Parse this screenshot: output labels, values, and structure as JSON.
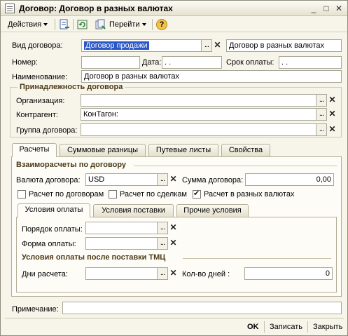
{
  "window": {
    "title": "Договор: Договор  в разных валютах"
  },
  "toolbar": {
    "actions_label": "Действия",
    "goto_label": "Перейти"
  },
  "form": {
    "vid_label": "Вид договора:",
    "vid_value": "Договор  продажи",
    "vid_name_value": "Договор  в разных валютах",
    "nomer_label": "Номер:",
    "nomer_value": "",
    "data_label": "Дата:",
    "data_value": " .  .",
    "srok_label": "Срок оплаты:",
    "srok_value": " .  .",
    "naim_label": "Наименование:",
    "naim_value": "Договор  в разных валютах"
  },
  "ownership": {
    "title": "Принадлежность договора",
    "org_label": "Организация:",
    "org_value": "",
    "kontr_label": "Контрагент:",
    "kontr_value": "КонТагон:",
    "group_label": "Группа договора:",
    "group_value": ""
  },
  "tabs": [
    "Расчеты",
    "Суммовые разницы",
    "Путевые листы",
    "Свойства"
  ],
  "settlements": {
    "title": "Взаиморасчеты по договору",
    "currency_label": "Валюта договора:",
    "currency_value": "USD",
    "sum_label": "Сумма договора:",
    "sum_value": "0,00",
    "cb_contracts": "Расчет по договорам",
    "cb_deals": "Расчет по сделкам",
    "cb_currencies": "Расчет в разных валютах",
    "cb_contracts_checked": false,
    "cb_deals_checked": false,
    "cb_currencies_checked": true
  },
  "subtabs": [
    "Условия оплаты",
    "Условия поставки",
    "Прочие условия"
  ],
  "payment": {
    "order_label": "Порядок оплаты:",
    "order_value": "",
    "form_label": "Форма оплаты:",
    "form_value": "",
    "after_title": "Условия оплаты после поставки ТМЦ",
    "days_label": "Дни расчета:",
    "days_value": "",
    "count_label": "Кол-во дней :",
    "count_value": "0"
  },
  "note": {
    "label": "Примечание:",
    "value": ""
  },
  "footer": {
    "ok": "OK",
    "save": "Записать",
    "close": "Закрыть"
  },
  "colors": {
    "accent_title": "#4b3a17",
    "selection": "#2a56c6"
  }
}
